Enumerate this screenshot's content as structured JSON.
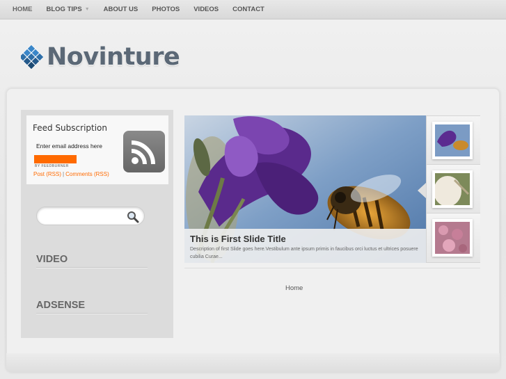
{
  "nav": {
    "items": [
      {
        "label": "HOME"
      },
      {
        "label": "BLOG TIPS",
        "has_dropdown": true
      },
      {
        "label": "ABOUT US"
      },
      {
        "label": "PHOTOS"
      },
      {
        "label": "VIDEOS"
      },
      {
        "label": "CONTACT"
      }
    ]
  },
  "logo": {
    "text": "Novinture",
    "icon": "cube-cluster-logo-icon",
    "color": "#5b6876"
  },
  "feed": {
    "title": "Feed Subscription",
    "email_placeholder": "Enter email address here",
    "by_feedburner": "BY FEEDBURNER",
    "post_link": "Post (RSS)",
    "comments_link": "Comments (RSS)",
    "icon": "rss-icon",
    "accent_color": "#ff6a00"
  },
  "search": {
    "placeholder": "",
    "icon": "search-icon"
  },
  "widgets": {
    "video": "VIDEO",
    "adsense": "ADSENSE"
  },
  "slider": {
    "title": "This is First Slide Title",
    "description": "Description of first Slide goes here.Vestibulum ante ipsum primis in faucibus orci luctus et ultrices posuere cubilia Curae..."
  },
  "breadcrumb": {
    "home": "Home"
  }
}
